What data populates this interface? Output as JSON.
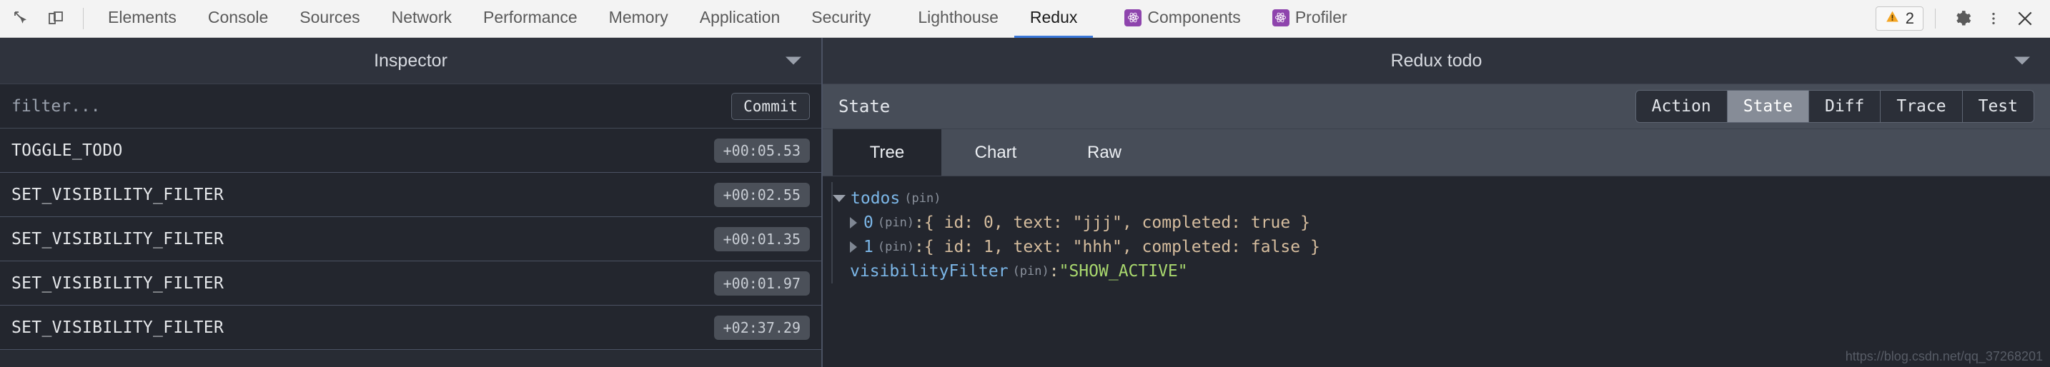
{
  "devtools_toolbar": {
    "icons": [
      {
        "name": "inspect-element-icon",
        "label": "Inspect element"
      },
      {
        "name": "device-toolbar-icon",
        "label": "Toggle device toolbar"
      }
    ],
    "tabs": [
      {
        "label": "Elements",
        "selected": false,
        "badge": null
      },
      {
        "label": "Console",
        "selected": false,
        "badge": null
      },
      {
        "label": "Sources",
        "selected": false,
        "badge": null
      },
      {
        "label": "Network",
        "selected": false,
        "badge": null
      },
      {
        "label": "Performance",
        "selected": false,
        "badge": null
      },
      {
        "label": "Memory",
        "selected": false,
        "badge": null
      },
      {
        "label": "Application",
        "selected": false,
        "badge": null
      },
      {
        "label": "Security",
        "selected": false,
        "badge": null
      },
      {
        "label": "Lighthouse",
        "selected": false,
        "badge": null
      },
      {
        "label": "Redux",
        "selected": true,
        "badge": null
      },
      {
        "label": "Components",
        "selected": false,
        "badge": "react-logo-icon"
      },
      {
        "label": "Profiler",
        "selected": false,
        "badge": "react-logo-icon"
      }
    ],
    "warnings": {
      "icon": "warning-triangle-icon",
      "count": "2"
    },
    "settings_icon": "gear-icon",
    "more_icon": "kebab-menu-icon",
    "close_icon": "close-icon",
    "accent_color": "#3a77d8",
    "react_badge_color": "#8e44ad",
    "warning_color": "#f5a623"
  },
  "inspector": {
    "title": "Inspector",
    "collapse_icon": "chevron-down-icon",
    "filter_placeholder": "filter...",
    "filter_value": "",
    "commit_label": "Commit",
    "actions": [
      {
        "name": "TOGGLE_TODO",
        "time": "+00:05.53"
      },
      {
        "name": "SET_VISIBILITY_FILTER",
        "time": "+00:02.55"
      },
      {
        "name": "SET_VISIBILITY_FILTER",
        "time": "+00:01.35"
      },
      {
        "name": "SET_VISIBILITY_FILTER",
        "time": "+00:01.97"
      },
      {
        "name": "SET_VISIBILITY_FILTER",
        "time": "+02:37.29"
      }
    ]
  },
  "monitor": {
    "title": "Redux todo",
    "collapse_icon": "chevron-down-icon",
    "state_label": "State",
    "view_tabs": [
      {
        "label": "Action",
        "active": false
      },
      {
        "label": "State",
        "active": true
      },
      {
        "label": "Diff",
        "active": false
      },
      {
        "label": "Trace",
        "active": false
      },
      {
        "label": "Test",
        "active": false
      }
    ],
    "sub_tabs": [
      {
        "label": "Tree",
        "active": true
      },
      {
        "label": "Chart",
        "active": false
      },
      {
        "label": "Raw",
        "active": false
      }
    ],
    "tree": {
      "root": {
        "key": "todos",
        "pin": "(pin)",
        "expanded": true
      },
      "children": [
        {
          "index": "0",
          "pin": "(pin)",
          "separator": ": ",
          "value": "{ id: 0, text: \"jjj\", completed: true }"
        },
        {
          "index": "1",
          "pin": "(pin)",
          "separator": ": ",
          "value": "{ id: 1, text: \"hhh\", completed: false }"
        }
      ],
      "leaf": {
        "key": "visibilityFilter",
        "pin": "(pin)",
        "separator": ": ",
        "value": "\"SHOW_ACTIVE\""
      }
    },
    "colors": {
      "key": "#7cb7e8",
      "string": "#a9d86e",
      "object": "#d6bd9e",
      "background": "#23262e"
    }
  },
  "watermark": "https://blog.csdn.net/qq_37268201"
}
